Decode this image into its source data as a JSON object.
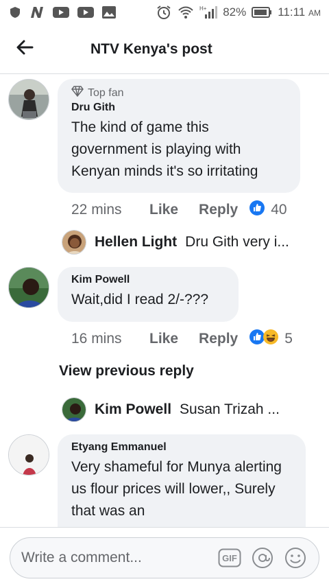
{
  "status_bar": {
    "battery": "82%",
    "time": "11:11",
    "ampm": "AM",
    "icons": [
      "shield-icon",
      "n-app-icon",
      "youtube-icon",
      "youtube-icon",
      "image-icon",
      "alarm-icon",
      "wifi-icon",
      "signal-icon",
      "battery-icon"
    ]
  },
  "header": {
    "title": "NTV Kenya's post",
    "back_icon": "arrow-left-icon"
  },
  "comments": [
    {
      "badge": "Top fan",
      "author": "Dru Gith",
      "text": "The kind of game this government is playing with Kenyan minds it's so irritating",
      "time": "22 mins",
      "like": "Like",
      "reply": "Reply",
      "reaction_count": "40",
      "reactions": [
        "like-icon"
      ]
    },
    {
      "author": "Kim Powell",
      "text": "Wait,did I read 2/-???",
      "time": "16 mins",
      "like": "Like",
      "reply": "Reply",
      "reaction_count": "5",
      "reactions": [
        "like-icon",
        "haha-icon"
      ]
    },
    {
      "author": "Etyang Emmanuel",
      "text": "Very shameful for Munya alerting us flour prices will lower,, Surely  that was an"
    }
  ],
  "replies": [
    {
      "name": "Hellen Light",
      "text": "Dru Gith very i..."
    },
    {
      "name": "Kim Powell",
      "text": "Susan Trizah ..."
    }
  ],
  "view_previous": "View previous reply",
  "composer": {
    "placeholder": "Write a comment...",
    "icons": [
      "gif-icon",
      "at-mention-icon",
      "emoji-icon"
    ]
  },
  "colors": {
    "like_blue": "#1877f2",
    "bubble": "#f0f2f5",
    "secondary_text": "#65676b"
  }
}
